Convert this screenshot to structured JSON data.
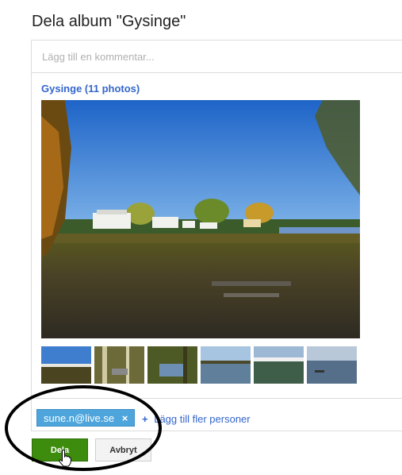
{
  "dialog": {
    "title": "Dela album \"Gysinge\"",
    "comment_placeholder": "Lägg till en kommentar...",
    "album_link": "Gysinge (11 photos)"
  },
  "recipients": {
    "chips": [
      {
        "email": "sune.n@live.se",
        "remove_glyph": "×"
      }
    ],
    "add_more_label": "Lägg till fler personer",
    "add_icon": "+"
  },
  "buttons": {
    "share_label": "Dela",
    "cancel_label": "Avbryt"
  },
  "colors": {
    "link": "#3366cc",
    "share_button": "#3d8c0d",
    "chip": "#4da5dc"
  },
  "icons": {
    "cursor": "hand-pointer-icon",
    "chip_remove": "close-icon"
  }
}
